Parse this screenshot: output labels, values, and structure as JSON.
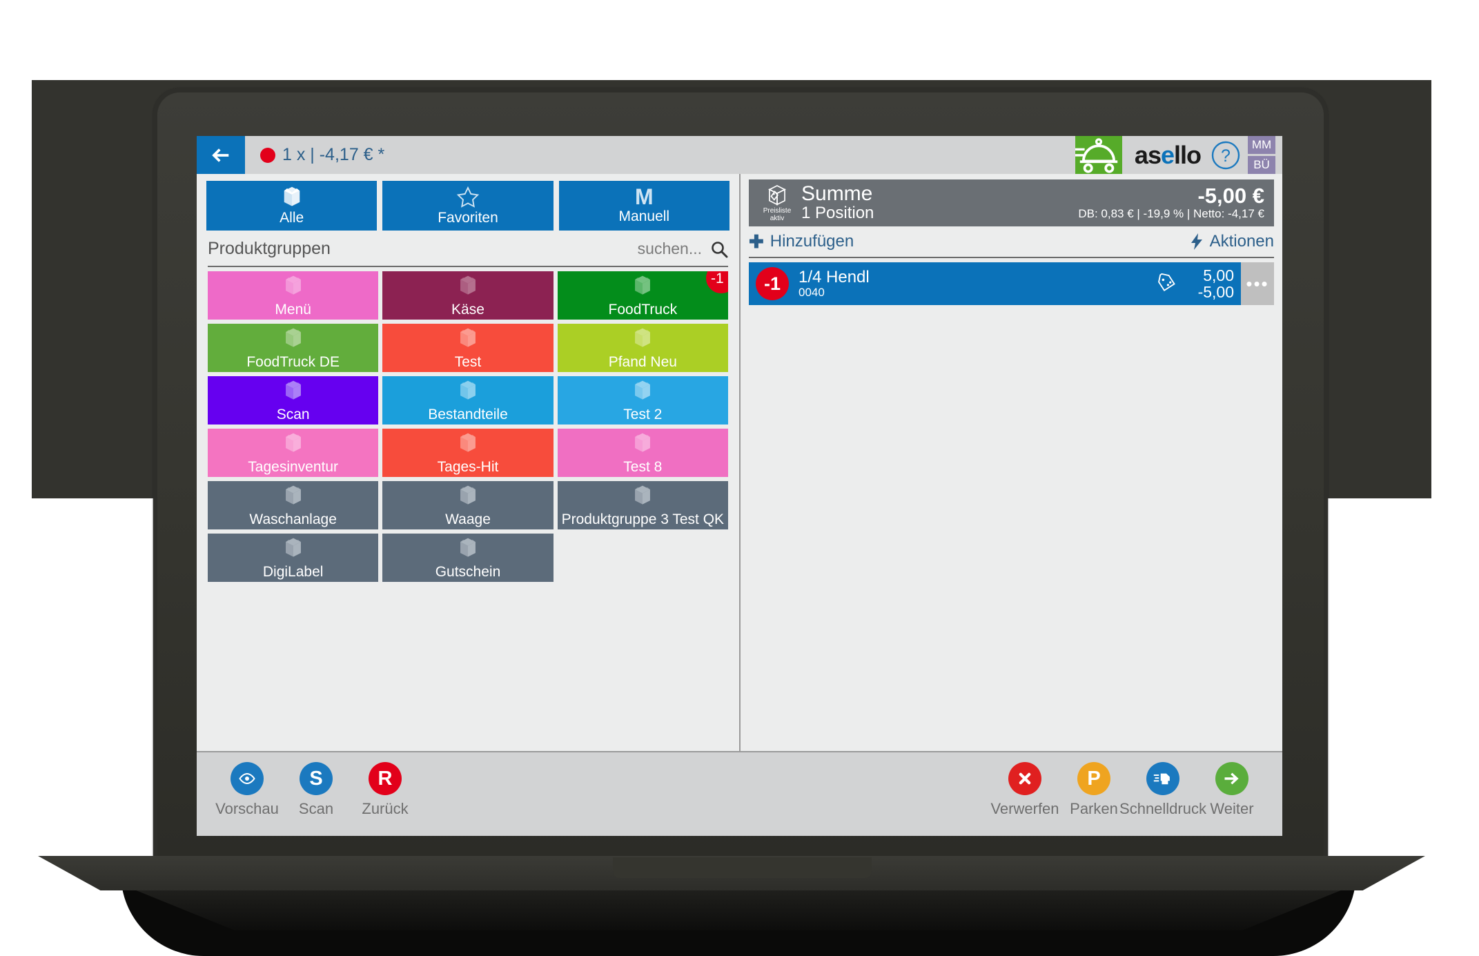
{
  "topbar": {
    "back_icon": "arrow-left-icon",
    "cart_summary": "1 x | -4,17 € *",
    "truck_icon": "food-delivery-cart-icon",
    "brand_part1": "as",
    "brand_part2": "e",
    "brand_part3": "llo",
    "help_icon": "help-question-icon",
    "user_badge_1": "MM",
    "user_badge_2": "BÜ"
  },
  "tabs": [
    {
      "label": "Alle",
      "icon": "open-box-icon"
    },
    {
      "label": "Favoriten",
      "icon": "star-icon"
    },
    {
      "label": "Manuell",
      "icon": "letter-m-icon"
    }
  ],
  "product_groups_header": {
    "title": "Produktgruppen",
    "search_placeholder": "suchen...",
    "search_icon": "search-icon"
  },
  "product_groups": [
    {
      "label": "Menü",
      "color": "#ee6ac8",
      "icon_color": "#f5a2dd",
      "badge": null
    },
    {
      "label": "Käse",
      "color": "#8c2252",
      "icon_color": "#b5708e",
      "badge": null
    },
    {
      "label": "FoodTruck",
      "color": "#038d1b",
      "icon_color": "#74c280",
      "badge": "-1"
    },
    {
      "label": "FoodTruck DE",
      "color": "#62ad3c",
      "icon_color": "#a9d192",
      "badge": null
    },
    {
      "label": "Test",
      "color": "#f74c3c",
      "icon_color": "#fb9b90",
      "badge": null
    },
    {
      "label": "Pfand Neu",
      "color": "#abcf25",
      "icon_color": "#cfe382",
      "badge": null
    },
    {
      "label": "Scan",
      "color": "#6600f0",
      "icon_color": "#ab80f7",
      "badge": null
    },
    {
      "label": "Bestandteile",
      "color": "#1b9fdb",
      "icon_color": "#8bd0ee",
      "badge": null
    },
    {
      "label": "Test 2",
      "color": "#28a6e3",
      "icon_color": "#93d3f1",
      "badge": null
    },
    {
      "label": "Tagesinventur",
      "color": "#f474c1",
      "icon_color": "#f9aedb",
      "badge": null
    },
    {
      "label": "Tages-Hit",
      "color": "#f74c3c",
      "icon_color": "#fb9b90",
      "badge": null
    },
    {
      "label": "Test 8",
      "color": "#f06fc2",
      "icon_color": "#f7abdb",
      "badge": null
    },
    {
      "label": "Waschanlage",
      "color": "#5c6b7a",
      "icon_color": "#aab4bd",
      "badge": null
    },
    {
      "label": "Waage",
      "color": "#5c6b7a",
      "icon_color": "#aab4bd",
      "badge": null
    },
    {
      "label": "Produktgruppe 3 Test QK",
      "color": "#5c6b7a",
      "icon_color": "#aab4bd",
      "badge": null
    },
    {
      "label": "DigiLabel",
      "color": "#5c6b7a",
      "icon_color": "#aab4bd",
      "badge": null
    },
    {
      "label": "Gutschein",
      "color": "#5c6b7a",
      "icon_color": "#aab4bd",
      "badge": null
    }
  ],
  "summary": {
    "icon": "price-tag-box-icon",
    "icon_caption_line1": "Preisliste",
    "icon_caption_line2": "aktiv",
    "title": "Summe",
    "positions": "1 Position",
    "total": "-5,00 €",
    "meta": "DB: 0,83 € | -19,9 % | Netto: -4,17 €"
  },
  "actions": {
    "add_label": "Hinzufügen",
    "add_icon": "plus-icon",
    "actions_label": "Aktionen",
    "actions_icon": "lightning-bolt-icon"
  },
  "line_items": [
    {
      "qty": "-1",
      "name": "1/4 Hendl",
      "code": "0040",
      "tag_icon": "discount-tag-icon",
      "price": "5,00",
      "total": "-5,00",
      "more_label": "•••"
    }
  ],
  "bottom_left_buttons": [
    {
      "label": "Vorschau",
      "icon": "eye-icon",
      "glyph": "",
      "color": "#1b79bf"
    },
    {
      "label": "Scan",
      "icon": "letter-s-icon",
      "glyph": "S",
      "color": "#1b79bf"
    },
    {
      "label": "Zurück",
      "icon": "letter-r-icon",
      "glyph": "R",
      "color": "#e2001a"
    }
  ],
  "bottom_right_buttons": [
    {
      "label": "Verwerfen",
      "icon": "x-close-icon",
      "glyph": "",
      "color": "#e02020"
    },
    {
      "label": "Parken",
      "icon": "letter-p-icon",
      "glyph": "P",
      "color": "#efa420"
    },
    {
      "label": "Schnelldruck",
      "icon": "printer-icon",
      "glyph": "",
      "color": "#1b79bf"
    },
    {
      "label": "Weiter",
      "icon": "arrow-right-icon",
      "glyph": "",
      "color": "#5aad3c"
    }
  ]
}
